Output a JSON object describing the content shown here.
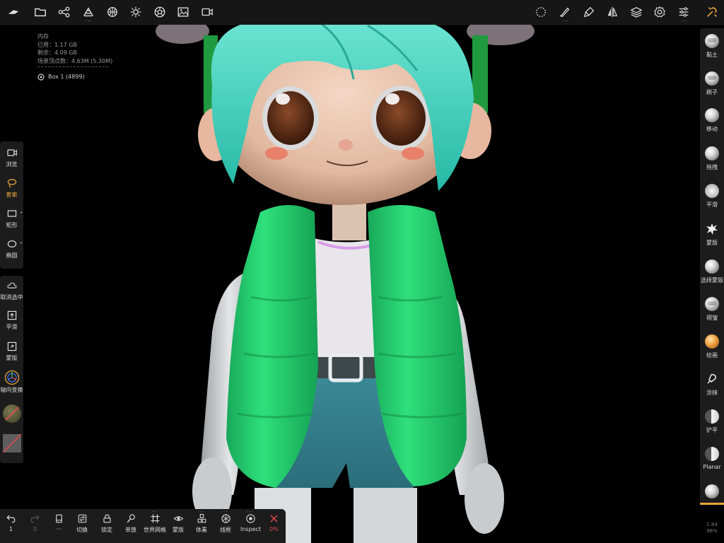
{
  "app": {
    "name": "Nomad Sculpt"
  },
  "info": {
    "memory_label": "内存",
    "used": "已用：1.17 GB",
    "free": "剩余：4.09 GB",
    "vertices": "场景顶点数：4.63M (5.30M)",
    "object": "Box 1 (4899)"
  },
  "left_tools": [
    {
      "label": "浏览",
      "icon": "camera-icon",
      "active": false
    },
    {
      "label": "套索",
      "icon": "lasso-icon",
      "active": true
    },
    {
      "label": "矩形",
      "icon": "rectangle-icon",
      "active": false
    },
    {
      "label": "椭圆",
      "icon": "ellipse-icon",
      "active": false
    }
  ],
  "left_actions": [
    {
      "label": "取消选中",
      "icon": "cloud-icon"
    },
    {
      "label": "平滑",
      "icon": "smooth-icon"
    },
    {
      "label": "蒙版",
      "icon": "mask-icon"
    },
    {
      "label": "轴向变换",
      "icon": "gizmo-icon"
    }
  ],
  "right_tools": [
    {
      "label": "黏土",
      "type": "ball"
    },
    {
      "label": "刷子",
      "type": "ball"
    },
    {
      "label": "移动",
      "type": "ball"
    },
    {
      "label": "拖拽",
      "type": "ball"
    },
    {
      "label": "平滑",
      "type": "ball"
    },
    {
      "label": "蒙版",
      "type": "splat"
    },
    {
      "label": "选择蒙版",
      "type": "ball"
    },
    {
      "label": "褶皱",
      "type": "ball"
    },
    {
      "label": "绘画",
      "type": "orange"
    },
    {
      "label": "涂抹",
      "type": "smudge"
    },
    {
      "label": "铲平",
      "type": "ball"
    },
    {
      "label": "Planar",
      "type": "ball"
    }
  ],
  "bottom": {
    "undo_count": "1",
    "redo_count": "0",
    "items": [
      {
        "label": "切换",
        "icon": "swap-icon"
      },
      {
        "label": "锁定",
        "icon": "lock-icon"
      },
      {
        "label": "单放",
        "icon": "solo-icon"
      },
      {
        "label": "世界网格",
        "icon": "grid-icon"
      },
      {
        "label": "蒙版",
        "icon": "eye-icon"
      },
      {
        "label": "体素",
        "icon": "voxel-icon"
      },
      {
        "label": "线框",
        "icon": "wireframe-icon"
      },
      {
        "label": "Inspect",
        "icon": "inspect-icon"
      }
    ],
    "close_percent": "0%"
  },
  "corner": {
    "line1": "1.84",
    "line2": "98%"
  },
  "colors": {
    "accent": "#e8a43a",
    "close": "#e24b4b",
    "hair": "#42d3bf",
    "vest": "#22d470"
  }
}
